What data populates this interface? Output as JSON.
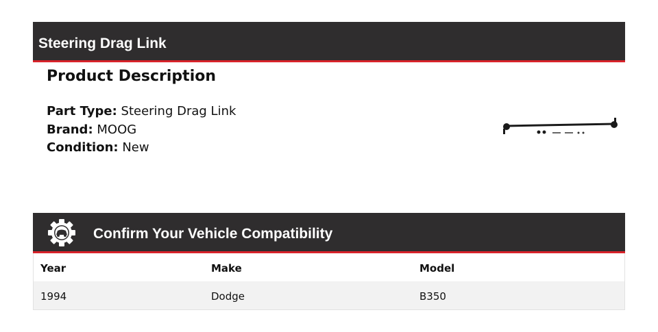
{
  "header": {
    "title": "Steering Drag Link"
  },
  "description": {
    "heading": "Product Description",
    "specs": [
      {
        "label": "Part Type:",
        "value": "Steering Drag Link"
      },
      {
        "label": "Brand:",
        "value": "MOOG"
      },
      {
        "label": "Condition:",
        "value": "New"
      }
    ],
    "image_icon": "steering-drag-link-product-image"
  },
  "compatibility": {
    "title": "Confirm Your Vehicle Compatibility",
    "icon": "gear-car-icon",
    "columns": [
      "Year",
      "Make",
      "Model"
    ],
    "rows": [
      [
        "1994",
        "Dodge",
        "B350"
      ]
    ]
  },
  "colors": {
    "bar": "#2f2d2e",
    "accent": "#d8232a",
    "row_alt": "#f2f2f2"
  }
}
